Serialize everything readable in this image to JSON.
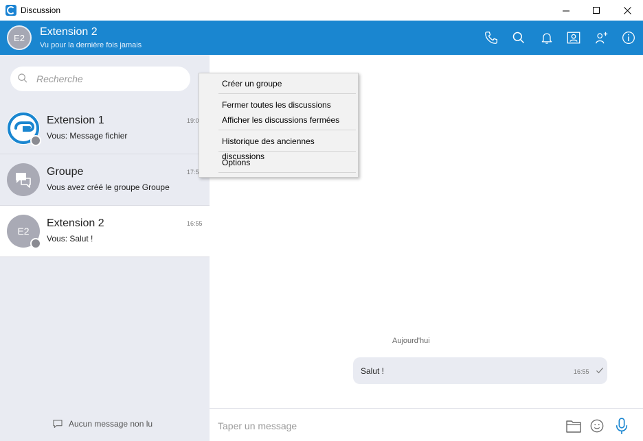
{
  "window": {
    "title": "Discussion",
    "minimize_label": "—",
    "maximize_label": "☐",
    "close_label": "✕"
  },
  "header": {
    "avatar_initials": "E2",
    "name": "Extension 2",
    "status": "Vu pour la dernière fois jamais",
    "icons": [
      "phone-icon",
      "search-icon",
      "bell-icon",
      "contact-card-icon",
      "add-user-icon",
      "info-icon"
    ]
  },
  "search": {
    "placeholder": "Recherche"
  },
  "conversations": [
    {
      "name": "Extension 1",
      "preview": "Vous: Message fichier",
      "time": "19:0",
      "avatar": "logo"
    },
    {
      "name": "Groupe",
      "preview": "Vous avez créé le groupe Groupe",
      "time": "17:5",
      "avatar": "group-chat-icon"
    },
    {
      "name": "Extension 2",
      "preview": "Vous: Salut !",
      "time": "16:55",
      "avatar_initials": "E2"
    }
  ],
  "sidebar_footer": {
    "unread_label": "Aucun message non lu"
  },
  "chat": {
    "date_separator": "Aujourd'hui",
    "messages": [
      {
        "text": "Salut !",
        "time": "16:55",
        "status": "sent"
      }
    ]
  },
  "composer": {
    "placeholder": "Taper un message"
  },
  "context_menu": {
    "items": [
      "Créer un groupe",
      "Fermer toutes les discussions",
      "Afficher les discussions fermées",
      "Historique des anciennes discussions",
      "Options"
    ]
  },
  "colors": {
    "accent": "#1a86d0",
    "sidebar_bg": "#e9ebf2",
    "avatar_gray": "#a9aab5"
  }
}
